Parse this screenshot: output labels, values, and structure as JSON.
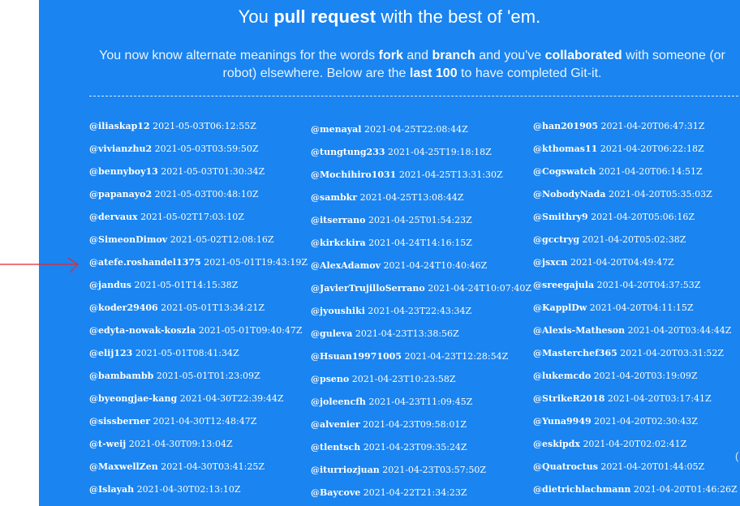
{
  "header": {
    "title_pre": "You ",
    "title_bold": "pull request",
    "title_post": " with the best of 'em."
  },
  "intro": {
    "p1": "You now know alternate meanings for the words ",
    "b1": "fork",
    "p2": " and ",
    "b2": "branch",
    "p3": " and you've ",
    "b3": "collaborated",
    "p4": " with someone (or robot) elsewhere. Below are the ",
    "b4": "last 100",
    "p5": " to have completed Git-it."
  },
  "columns": [
    {
      "entries": [
        {
          "user": "@iliaskap12",
          "time": "2021-05-03T06:12:55Z"
        },
        {
          "user": "@vivianzhu2",
          "time": "2021-05-03T03:59:50Z"
        },
        {
          "user": "@bennyboy13",
          "time": "2021-05-03T01:30:34Z"
        },
        {
          "user": "@papanayo2",
          "time": "2021-05-03T00:48:10Z"
        },
        {
          "user": "@dervaux",
          "time": "2021-05-02T17:03:10Z"
        },
        {
          "user": "@SimeonDimov",
          "time": "2021-05-02T12:08:16Z"
        },
        {
          "user": "@atefe.roshandel1375",
          "time": "2021-05-01T19:43:19Z"
        },
        {
          "user": "@jandus",
          "time": "2021-05-01T14:15:38Z"
        },
        {
          "user": "@koder29406",
          "time": "2021-05-01T13:34:21Z"
        },
        {
          "user": "@edyta-nowak-koszla",
          "time": "2021-05-01T09:40:47Z"
        },
        {
          "user": "@elij123",
          "time": "2021-05-01T08:41:34Z"
        },
        {
          "user": "@bambambb",
          "time": "2021-05-01T01:23:09Z"
        },
        {
          "user": "@byeongjae-kang",
          "time": "2021-04-30T22:39:44Z"
        },
        {
          "user": "@sissberner",
          "time": "2021-04-30T12:48:47Z"
        },
        {
          "user": "@t-weij",
          "time": "2021-04-30T09:13:04Z"
        },
        {
          "user": "@MaxwellZen",
          "time": "2021-04-30T03:41:25Z"
        },
        {
          "user": "@Islayah",
          "time": "2021-04-30T02:13:10Z"
        }
      ]
    },
    {
      "entries": [
        {
          "user": "@menayal",
          "time": "2021-04-25T22:08:44Z"
        },
        {
          "user": "@tungtung233",
          "time": "2021-04-25T19:18:18Z"
        },
        {
          "user": "@Mochihiro1031",
          "time": "2021-04-25T13:31:30Z"
        },
        {
          "user": "@sambkr",
          "time": "2021-04-25T13:08:44Z"
        },
        {
          "user": "@itserrano",
          "time": "2021-04-25T01:54:23Z"
        },
        {
          "user": "@kirkckira",
          "time": "2021-04-24T14:16:15Z"
        },
        {
          "user": "@AlexAdamov",
          "time": "2021-04-24T10:40:46Z"
        },
        {
          "user": "@JavierTrujilloSerrano",
          "time": "2021-04-24T10:07:40Z"
        },
        {
          "user": "@jyoushiki",
          "time": "2021-04-23T22:43:34Z"
        },
        {
          "user": "@guleva",
          "time": "2021-04-23T13:38:56Z"
        },
        {
          "user": "@Hsuan19971005",
          "time": "2021-04-23T12:28:54Z"
        },
        {
          "user": "@pseno",
          "time": "2021-04-23T10:23:58Z"
        },
        {
          "user": "@joleencfh",
          "time": "2021-04-23T11:09:45Z"
        },
        {
          "user": "@alvenier",
          "time": "2021-04-23T09:58:01Z"
        },
        {
          "user": "@tlentsch",
          "time": "2021-04-23T09:35:24Z"
        },
        {
          "user": "@iturriozjuan",
          "time": "2021-04-23T03:57:50Z"
        },
        {
          "user": "@Baycove",
          "time": "2021-04-22T21:34:23Z"
        }
      ]
    },
    {
      "entries": [
        {
          "user": "@han201905",
          "time": "2021-04-20T06:47:31Z"
        },
        {
          "user": "@kthomas11",
          "time": "2021-04-20T06:22:18Z"
        },
        {
          "user": "@Cogswatch",
          "time": "2021-04-20T06:14:51Z"
        },
        {
          "user": "@NobodyNada",
          "time": "2021-04-20T05:35:03Z"
        },
        {
          "user": "@Smithry9",
          "time": "2021-04-20T05:06:16Z"
        },
        {
          "user": "@gcctryg",
          "time": "2021-04-20T05:02:38Z"
        },
        {
          "user": "@jsxcn",
          "time": "2021-04-20T04:49:47Z"
        },
        {
          "user": "@sreegajula",
          "time": "2021-04-20T04:37:53Z"
        },
        {
          "user": "@KapplDw",
          "time": "2021-04-20T04:11:15Z"
        },
        {
          "user": "@Alexis-Matheson",
          "time": "2021-04-20T03:44:44Z"
        },
        {
          "user": "@Masterchef365",
          "time": "2021-04-20T03:31:52Z"
        },
        {
          "user": "@lukemcdo",
          "time": "2021-04-20T03:19:09Z"
        },
        {
          "user": "@StrikeR2018",
          "time": "2021-04-20T03:17:41Z"
        },
        {
          "user": "@Yuna9949",
          "time": "2021-04-20T02:30:43Z"
        },
        {
          "user": "@eskipdx",
          "time": "2021-04-20T02:02:41Z"
        },
        {
          "user": "@Quatroctus",
          "time": "2021-04-20T01:44:05Z"
        },
        {
          "user": "@dietrichlachmann",
          "time": "2021-04-20T01:46:26Z"
        }
      ]
    }
  ],
  "edge_glyph": "(",
  "colors": {
    "panel": "#1a84f0",
    "text": "#ffffff",
    "annotation_arrow": "#e8262a"
  },
  "icons": {
    "annotation": "red-arrow-icon"
  }
}
